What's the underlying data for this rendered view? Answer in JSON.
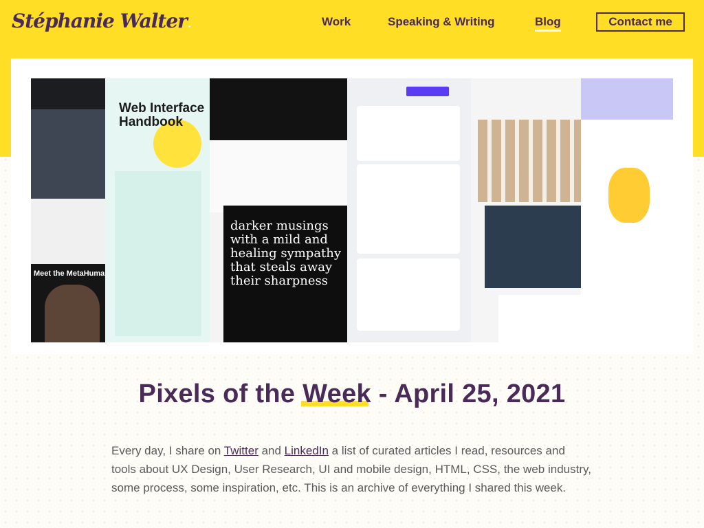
{
  "header": {
    "logo": "Stéphanie Walter",
    "nav": [
      {
        "label": "Work"
      },
      {
        "label": "Speaking & Writing"
      },
      {
        "label": "Blog"
      }
    ],
    "contact_label": "Contact me"
  },
  "hero": {
    "book_title": "Web Interface Handbook",
    "metahumans_text": "Meet the MetaHumans",
    "poem_text": "darker musings with a mild and healing sympathy that steals away their sharpness"
  },
  "post": {
    "title_pre": "Pixels of the ",
    "title_highlight": "Week",
    "title_post": " - April 25, 2021",
    "intro_pre": "Every day, I share on ",
    "link_twitter": "Twitter",
    "intro_and": " and ",
    "link_linkedin": "LinkedIn",
    "intro_post": " a list of curated articles I read, resources and tools about UX Design, User Research, UI and mobile design, HTML, CSS, the web industry, some process, some inspiration, etc. This is an archive of everything I shared this week."
  },
  "colors": {
    "brand_yellow": "#ffde25",
    "brand_purple": "#4a2a57"
  }
}
